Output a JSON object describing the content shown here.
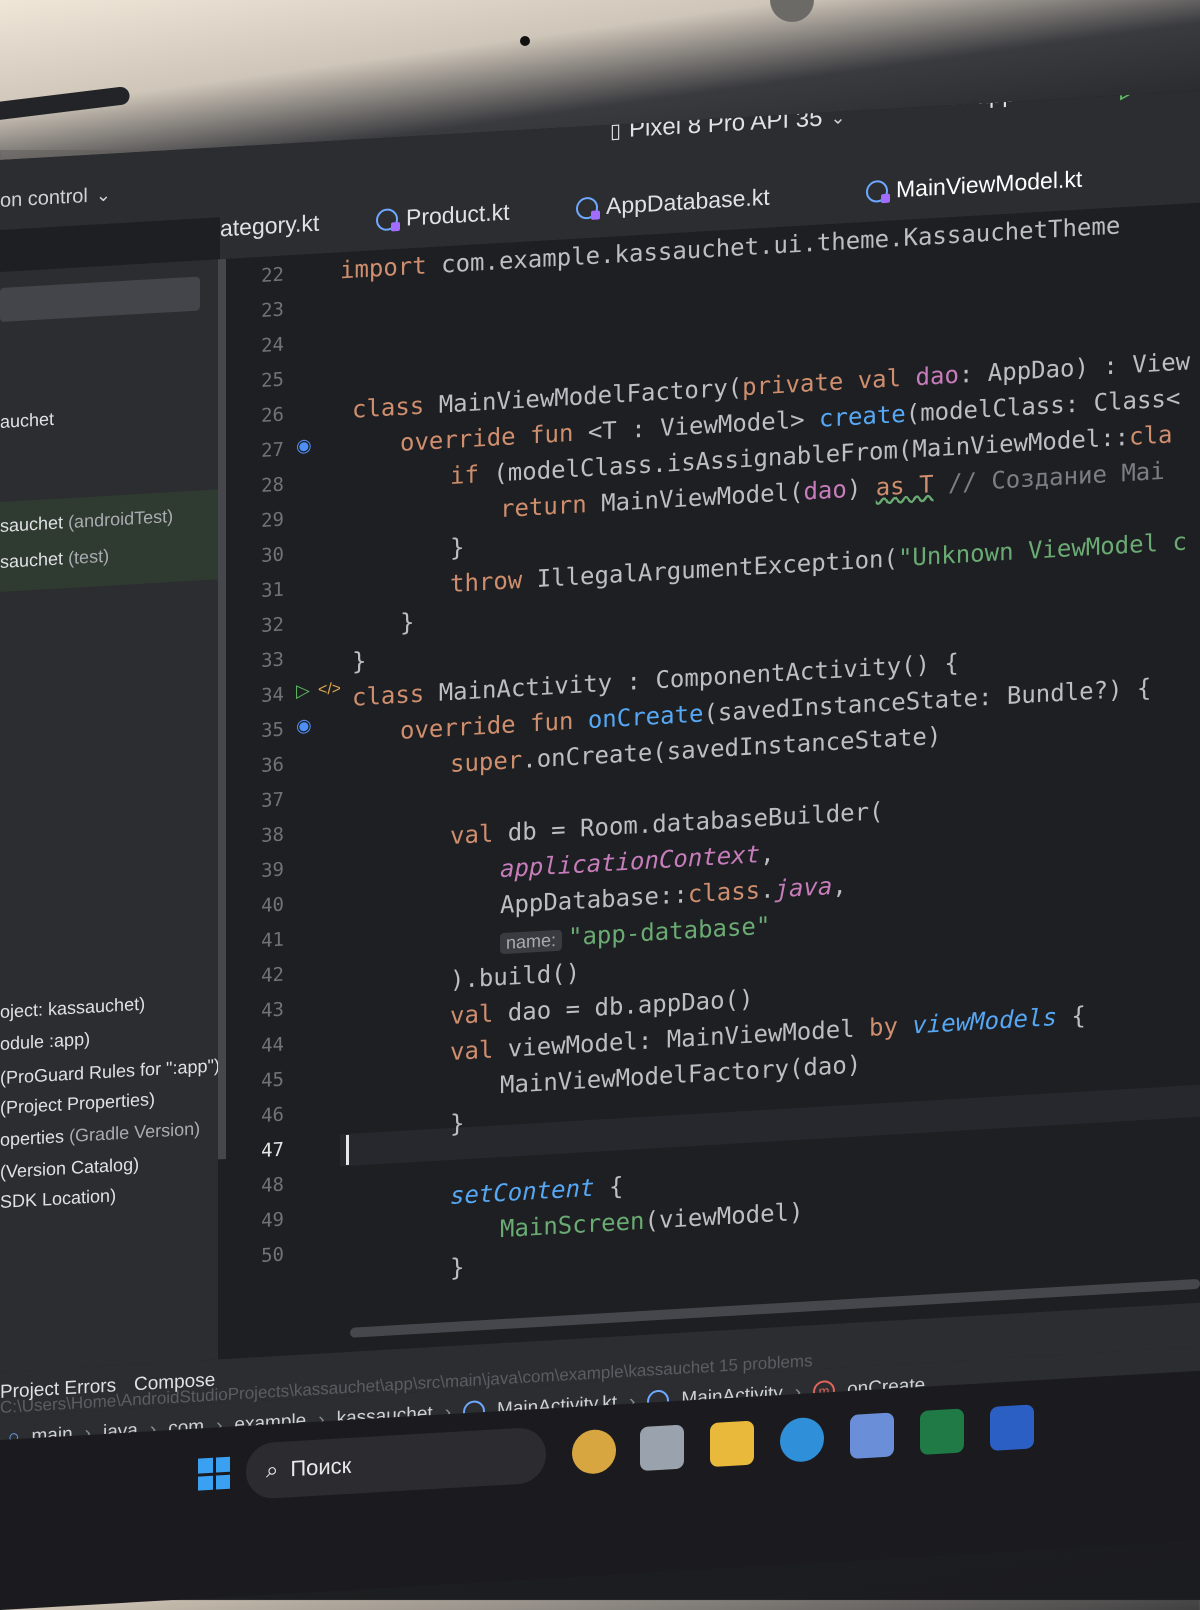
{
  "toolbar": {
    "version_control": "on control",
    "device": "Pixel 8 Pro API 35",
    "run_config": "app"
  },
  "tabs": [
    {
      "label": "ategory.kt"
    },
    {
      "label": "Product.kt"
    },
    {
      "label": "AppDatabase.kt"
    },
    {
      "label": "MainViewModel.kt"
    }
  ],
  "project_tree": {
    "rows": [
      {
        "text": "auchet",
        "muted": ""
      },
      {
        "text": "sauchet",
        "muted": "(androidTest)"
      },
      {
        "text": "sauchet",
        "muted": "(test)"
      },
      {
        "text": "oject: kassauchet)",
        "muted": ""
      },
      {
        "text": "odule :app)",
        "muted": ""
      },
      {
        "text": "(ProGuard Rules for \":app\")",
        "muted": ""
      },
      {
        "text": "(Project Properties)",
        "muted": ""
      },
      {
        "text": "operties",
        "muted": "(Gradle Version)"
      },
      {
        "text": "(Version Catalog)",
        "muted": ""
      },
      {
        "text": "SDK Location)",
        "muted": ""
      }
    ]
  },
  "editor": {
    "line_numbers": [
      "22",
      "23",
      "24",
      "25",
      "26",
      "27",
      "28",
      "29",
      "30",
      "31",
      "32",
      "33",
      "34",
      "35",
      "36",
      "37",
      "38",
      "39",
      "40",
      "41",
      "42",
      "43",
      "44",
      "45",
      "46",
      "47",
      "48",
      "49",
      "50"
    ],
    "current_line": "47",
    "inlay_hint": "name:",
    "comment": "// Создание Mai"
  },
  "bottom_tabs": {
    "project_errors": "Project Errors",
    "compose": "Compose"
  },
  "breadcrumb": {
    "ghost_path": "C:\\Users\\Home\\AndroidStudioProjects\\kassauchet\\app\\src\\main\\java\\com\\example\\kassauchet   15 problems",
    "items": [
      "main",
      "java",
      "com",
      "example",
      "kassauchet",
      "MainActivity.kt",
      "MainActivity",
      "onCreate"
    ]
  },
  "taskbar": {
    "search_label": "Поиск"
  }
}
